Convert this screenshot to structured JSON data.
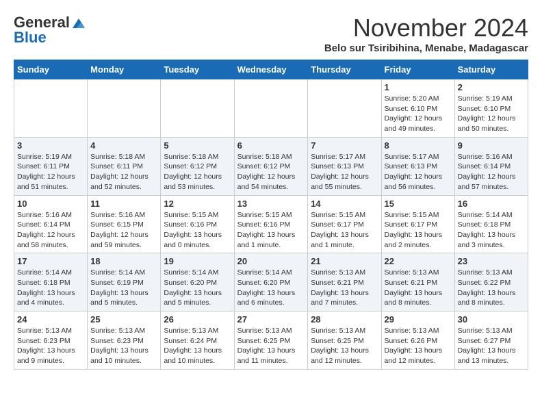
{
  "header": {
    "logo_general": "General",
    "logo_blue": "Blue",
    "month_title": "November 2024",
    "location": "Belo sur Tsiribihina, Menabe, Madagascar"
  },
  "weekdays": [
    "Sunday",
    "Monday",
    "Tuesday",
    "Wednesday",
    "Thursday",
    "Friday",
    "Saturday"
  ],
  "weeks": [
    [
      {
        "day": "",
        "info": ""
      },
      {
        "day": "",
        "info": ""
      },
      {
        "day": "",
        "info": ""
      },
      {
        "day": "",
        "info": ""
      },
      {
        "day": "",
        "info": ""
      },
      {
        "day": "1",
        "info": "Sunrise: 5:20 AM\nSunset: 6:10 PM\nDaylight: 12 hours\nand 49 minutes."
      },
      {
        "day": "2",
        "info": "Sunrise: 5:19 AM\nSunset: 6:10 PM\nDaylight: 12 hours\nand 50 minutes."
      }
    ],
    [
      {
        "day": "3",
        "info": "Sunrise: 5:19 AM\nSunset: 6:11 PM\nDaylight: 12 hours\nand 51 minutes."
      },
      {
        "day": "4",
        "info": "Sunrise: 5:18 AM\nSunset: 6:11 PM\nDaylight: 12 hours\nand 52 minutes."
      },
      {
        "day": "5",
        "info": "Sunrise: 5:18 AM\nSunset: 6:12 PM\nDaylight: 12 hours\nand 53 minutes."
      },
      {
        "day": "6",
        "info": "Sunrise: 5:18 AM\nSunset: 6:12 PM\nDaylight: 12 hours\nand 54 minutes."
      },
      {
        "day": "7",
        "info": "Sunrise: 5:17 AM\nSunset: 6:13 PM\nDaylight: 12 hours\nand 55 minutes."
      },
      {
        "day": "8",
        "info": "Sunrise: 5:17 AM\nSunset: 6:13 PM\nDaylight: 12 hours\nand 56 minutes."
      },
      {
        "day": "9",
        "info": "Sunrise: 5:16 AM\nSunset: 6:14 PM\nDaylight: 12 hours\nand 57 minutes."
      }
    ],
    [
      {
        "day": "10",
        "info": "Sunrise: 5:16 AM\nSunset: 6:14 PM\nDaylight: 12 hours\nand 58 minutes."
      },
      {
        "day": "11",
        "info": "Sunrise: 5:16 AM\nSunset: 6:15 PM\nDaylight: 12 hours\nand 59 minutes."
      },
      {
        "day": "12",
        "info": "Sunrise: 5:15 AM\nSunset: 6:16 PM\nDaylight: 13 hours\nand 0 minutes."
      },
      {
        "day": "13",
        "info": "Sunrise: 5:15 AM\nSunset: 6:16 PM\nDaylight: 13 hours\nand 1 minute."
      },
      {
        "day": "14",
        "info": "Sunrise: 5:15 AM\nSunset: 6:17 PM\nDaylight: 13 hours\nand 1 minute."
      },
      {
        "day": "15",
        "info": "Sunrise: 5:15 AM\nSunset: 6:17 PM\nDaylight: 13 hours\nand 2 minutes."
      },
      {
        "day": "16",
        "info": "Sunrise: 5:14 AM\nSunset: 6:18 PM\nDaylight: 13 hours\nand 3 minutes."
      }
    ],
    [
      {
        "day": "17",
        "info": "Sunrise: 5:14 AM\nSunset: 6:18 PM\nDaylight: 13 hours\nand 4 minutes."
      },
      {
        "day": "18",
        "info": "Sunrise: 5:14 AM\nSunset: 6:19 PM\nDaylight: 13 hours\nand 5 minutes."
      },
      {
        "day": "19",
        "info": "Sunrise: 5:14 AM\nSunset: 6:20 PM\nDaylight: 13 hours\nand 5 minutes."
      },
      {
        "day": "20",
        "info": "Sunrise: 5:14 AM\nSunset: 6:20 PM\nDaylight: 13 hours\nand 6 minutes."
      },
      {
        "day": "21",
        "info": "Sunrise: 5:13 AM\nSunset: 6:21 PM\nDaylight: 13 hours\nand 7 minutes."
      },
      {
        "day": "22",
        "info": "Sunrise: 5:13 AM\nSunset: 6:21 PM\nDaylight: 13 hours\nand 8 minutes."
      },
      {
        "day": "23",
        "info": "Sunrise: 5:13 AM\nSunset: 6:22 PM\nDaylight: 13 hours\nand 8 minutes."
      }
    ],
    [
      {
        "day": "24",
        "info": "Sunrise: 5:13 AM\nSunset: 6:23 PM\nDaylight: 13 hours\nand 9 minutes."
      },
      {
        "day": "25",
        "info": "Sunrise: 5:13 AM\nSunset: 6:23 PM\nDaylight: 13 hours\nand 10 minutes."
      },
      {
        "day": "26",
        "info": "Sunrise: 5:13 AM\nSunset: 6:24 PM\nDaylight: 13 hours\nand 10 minutes."
      },
      {
        "day": "27",
        "info": "Sunrise: 5:13 AM\nSunset: 6:25 PM\nDaylight: 13 hours\nand 11 minutes."
      },
      {
        "day": "28",
        "info": "Sunrise: 5:13 AM\nSunset: 6:25 PM\nDaylight: 13 hours\nand 12 minutes."
      },
      {
        "day": "29",
        "info": "Sunrise: 5:13 AM\nSunset: 6:26 PM\nDaylight: 13 hours\nand 12 minutes."
      },
      {
        "day": "30",
        "info": "Sunrise: 5:13 AM\nSunset: 6:27 PM\nDaylight: 13 hours\nand 13 minutes."
      }
    ]
  ]
}
